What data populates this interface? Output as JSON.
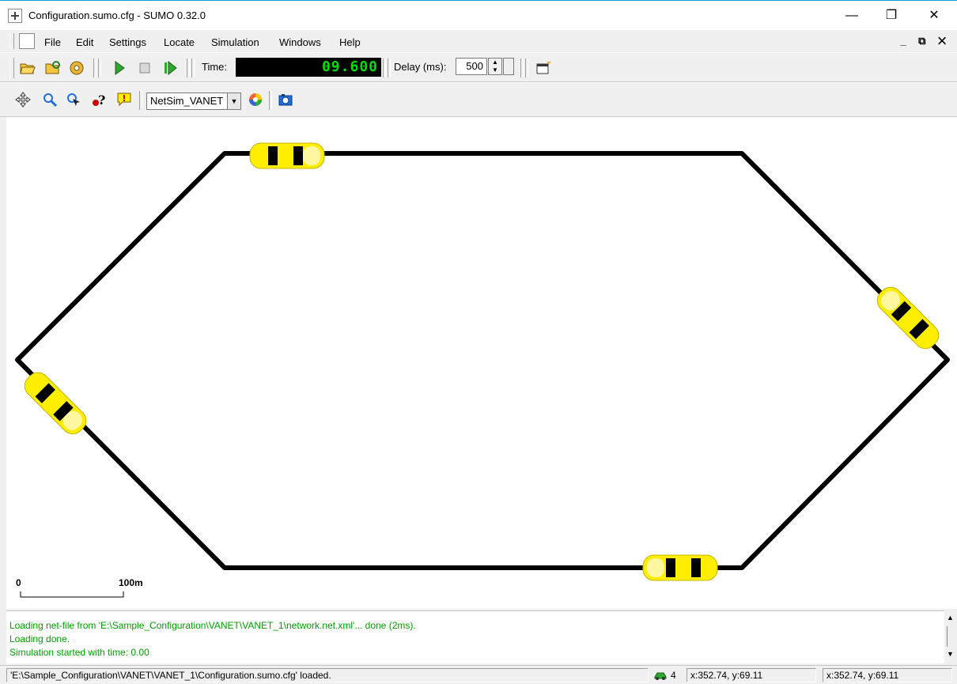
{
  "window": {
    "title": "Configuration.sumo.cfg - SUMO 0.32.0",
    "min_glyph": "—",
    "restore_glyph": "❐",
    "close_glyph": "✕"
  },
  "menubar": {
    "items": [
      {
        "label": "File"
      },
      {
        "label": "Edit"
      },
      {
        "label": "Settings"
      },
      {
        "label": "Locate"
      },
      {
        "label": "Simulation"
      },
      {
        "label": "Windows"
      },
      {
        "label": "Help"
      }
    ],
    "mdi_controls": "_ ⧉ ✕"
  },
  "toolbar": {
    "time_label": "Time:",
    "time_value": "09.600",
    "delay_label": "Delay (ms):",
    "delay_value": "500",
    "view_scheme": "NetSim_VANET",
    "icons": {
      "open": "folder-open-icon",
      "reload": "reload-icon",
      "close_sim": "close-sim-icon",
      "run": "play-icon",
      "stop": "stop-icon",
      "step": "step-icon",
      "new_view": "new-view-icon",
      "center": "recenter-icon",
      "locate": "magnifier-icon",
      "select": "select-icon",
      "query": "query-icon",
      "tooltip": "tooltip-icon",
      "edit_view": "color-wheel-icon",
      "screenshot": "camera-icon"
    },
    "colors": {
      "lcd_text": "#00e000",
      "lcd_bg": "#000000"
    }
  },
  "canvas": {
    "scale_start": "0",
    "scale_end": "100m",
    "vehicle_color": "#ffee00",
    "road_color": "#000000"
  },
  "log": {
    "lines": [
      "Loading net-file from 'E:\\Sample_Configuration\\VANET\\VANET_1\\network.net.xml'... done (2ms).",
      "Loading done.",
      "Simulation started with time: 0.00"
    ],
    "color": "#00a000"
  },
  "status": {
    "message": "'E:\\Sample_Configuration\\VANET\\VANET_1\\Configuration.sumo.cfg' loaded.",
    "vehicle_count": "4",
    "coords_1": "x:352.74, y:69.11",
    "coords_2": "x:352.74, y:69.11"
  }
}
